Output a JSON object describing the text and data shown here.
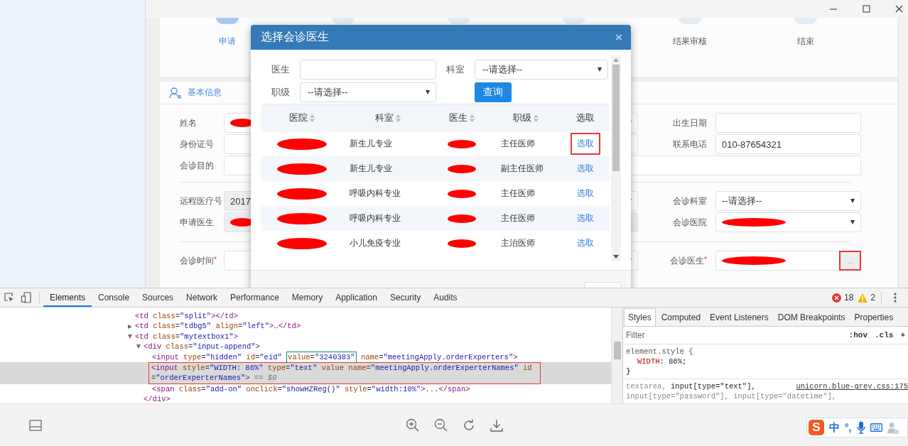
{
  "steps": [
    {
      "label": "申请",
      "selected": true
    },
    {
      "selected": false
    },
    {
      "selected": false
    },
    {
      "selected": false
    },
    {
      "label": "结果审核",
      "selected": false
    },
    {
      "label": "结束",
      "selected": false
    }
  ],
  "section": {
    "title": "基本信息"
  },
  "form_groups": [
    [
      {
        "left": {
          "label": "姓名",
          "kind": "text",
          "redacted": true
        },
        "middle": {
          "kind": "select"
        },
        "right": {
          "label": "出生日期",
          "kind": "text"
        }
      },
      {
        "left": {
          "label": "身份证号",
          "kind": "text"
        },
        "middle": {
          "kind": "text"
        },
        "right": {
          "label": "联系电话",
          "kind": "text",
          "value": "010-87654321"
        }
      },
      {
        "left": {
          "label": "会诊目的",
          "kind": "text",
          "wide": true
        }
      }
    ],
    [
      {
        "left": {
          "label": "远程医疗号",
          "kind": "text",
          "readonly": true,
          "value": "2017"
        },
        "middle": {
          "kind": "select"
        },
        "right": {
          "label": "会诊科室",
          "kind": "select",
          "value": "--请选择--"
        }
      },
      {
        "left": {
          "label": "申请医生",
          "kind": "text",
          "readonly": true,
          "redacted": true
        },
        "middle": {
          "kind": "text",
          "readonly": true
        },
        "right": {
          "label": "会诊医院",
          "kind": "select",
          "redacted": true
        }
      }
    ],
    [
      {
        "left": {
          "label": "会诊时间",
          "required_mark": "*",
          "kind": "text"
        },
        "middle": {
          "kind": "select"
        },
        "right": {
          "label": "会诊医生",
          "required_mark": "*",
          "kind": "lookup",
          "redacted": true,
          "button": "...",
          "annotated": true
        }
      }
    ]
  ],
  "modal": {
    "title": "选择会诊医生",
    "close": "×",
    "filters": [
      {
        "label": "医生",
        "kind": "text"
      },
      {
        "label": "科室",
        "kind": "select",
        "value": "--请选择--"
      },
      {
        "label": "职级",
        "kind": "select",
        "value": "--请选择--"
      }
    ],
    "search_button": "查询",
    "columns": [
      {
        "label": "医院",
        "sortable": true
      },
      {
        "label": "科室",
        "sortable": true
      },
      {
        "label": "医生",
        "sortable": true
      },
      {
        "label": "职级",
        "sortable": true
      },
      {
        "label": "选取",
        "sortable": false
      }
    ],
    "rows": [
      {
        "hospital_redacted": true,
        "department": "新生儿专业",
        "doctor_redacted": true,
        "title": "主任医师",
        "action": "选取",
        "annotated": true
      },
      {
        "hospital_redacted": true,
        "department": "新生儿专业",
        "doctor_redacted": true,
        "title": "副主任医师",
        "action": "选取",
        "annotated": false
      },
      {
        "hospital_redacted": true,
        "department": "呼吸内科专业",
        "doctor_redacted": true,
        "title": "主任医师",
        "action": "选取",
        "annotated": false
      },
      {
        "hospital_redacted": true,
        "department": "呼吸内科专业",
        "doctor_redacted": true,
        "title": "主任医师",
        "action": "选取",
        "annotated": false
      },
      {
        "hospital_redacted": true,
        "department": "小儿免疫专业",
        "doctor_redacted": true,
        "title": "主治医师",
        "action": "选取",
        "annotated": false
      }
    ]
  },
  "devtools": {
    "tabs": [
      {
        "label": "Elements",
        "selected": true
      },
      {
        "label": "Console",
        "selected": false
      },
      {
        "label": "Sources",
        "selected": false
      },
      {
        "label": "Network",
        "selected": false
      },
      {
        "label": "Performance",
        "selected": false
      },
      {
        "label": "Memory",
        "selected": false
      },
      {
        "label": "Application",
        "selected": false
      },
      {
        "label": "Security",
        "selected": false
      },
      {
        "label": "Audits",
        "selected": false
      }
    ],
    "errors": "18",
    "warnings": "2",
    "dom_tree": [
      {
        "kind": "leaf",
        "selected": false,
        "tokens": [
          {
            "kind": "tag",
            "text": "<td"
          },
          {
            "kind": "attr",
            "text": " class"
          },
          {
            "kind": "eq",
            "text": "="
          },
          {
            "kind": "value",
            "text": "\"split\""
          },
          {
            "kind": "tag",
            "text": "></td>"
          }
        ]
      },
      {
        "kind": "branch",
        "expanded": false,
        "selected": false,
        "tokens": [
          {
            "kind": "tag",
            "text": "<td"
          },
          {
            "kind": "attr",
            "text": " class"
          },
          {
            "kind": "eq",
            "text": "="
          },
          {
            "kind": "value",
            "text": "\"tdbg5\""
          },
          {
            "kind": "attr",
            "text": " align"
          },
          {
            "kind": "eq",
            "text": "="
          },
          {
            "kind": "value",
            "text": "\"left\""
          },
          {
            "kind": "tag",
            "text": ">"
          },
          {
            "kind": "plain",
            "text": "…"
          },
          {
            "kind": "tag",
            "text": "</td>"
          }
        ]
      },
      {
        "kind": "branch",
        "expanded": true,
        "selected": false,
        "tokens": [
          {
            "kind": "tag",
            "text": "<td"
          },
          {
            "kind": "attr",
            "text": " class"
          },
          {
            "kind": "eq",
            "text": "="
          },
          {
            "kind": "value",
            "text": "\"mytextbox1\""
          },
          {
            "kind": "tag",
            "text": ">"
          }
        ],
        "children": [
          {
            "kind": "branch",
            "expanded": true,
            "selected": false,
            "tokens": [
              {
                "kind": "tag",
                "text": "<div"
              },
              {
                "kind": "attr",
                "text": " class"
              },
              {
                "kind": "eq",
                "text": "="
              },
              {
                "kind": "value",
                "text": "\"input-append\""
              },
              {
                "kind": "tag",
                "text": ">"
              }
            ],
            "children": [
              {
                "kind": "leaf",
                "selected": false,
                "tokens": [
                  {
                    "kind": "tag",
                    "text": "<input"
                  },
                  {
                    "kind": "attr",
                    "text": " type"
                  },
                  {
                    "kind": "eq",
                    "text": "="
                  },
                  {
                    "kind": "value",
                    "text": "\"hidden\""
                  },
                  {
                    "kind": "attr",
                    "text": " id"
                  },
                  {
                    "kind": "eq",
                    "text": "="
                  },
                  {
                    "kind": "value",
                    "text": "\"eid\" "
                  },
                  {
                    "kind": "highlight",
                    "tokens": [
                      {
                        "kind": "attr",
                        "text": "value"
                      },
                      {
                        "kind": "eq",
                        "text": "="
                      },
                      {
                        "kind": "value",
                        "text": "\"3240383\""
                      }
                    ]
                  },
                  {
                    "kind": "attr",
                    "text": " name"
                  },
                  {
                    "kind": "eq",
                    "text": "="
                  },
                  {
                    "kind": "value",
                    "text": "\"meetingApply.orderExperters\""
                  },
                  {
                    "kind": "tag",
                    "text": ">"
                  }
                ]
              },
              {
                "kind": "leaf",
                "selected": true,
                "annotated": true,
                "tokens": [
                  {
                    "kind": "tag",
                    "text": "<input"
                  },
                  {
                    "kind": "attr",
                    "text": " style"
                  },
                  {
                    "kind": "eq",
                    "text": "="
                  },
                  {
                    "kind": "value",
                    "text": "\"WIDTH: 86%\""
                  },
                  {
                    "kind": "attr",
                    "text": " type"
                  },
                  {
                    "kind": "eq",
                    "text": "="
                  },
                  {
                    "kind": "value",
                    "text": "\"text\""
                  },
                  {
                    "kind": "attr",
                    "text": " value name"
                  },
                  {
                    "kind": "eq",
                    "text": "="
                  },
                  {
                    "kind": "value",
                    "text": "\"meetingApply.orderExperterNames\""
                  },
                  {
                    "kind": "attr",
                    "text": " id"
                  },
                  {
                    "kind": "eq",
                    "text": "="
                  },
                  {
                    "kind": "value",
                    "text": "\"orderExperterNames\""
                  },
                  {
                    "kind": "tag",
                    "text": ">"
                  },
                  {
                    "kind": "hint",
                    "text": " == $0"
                  }
                ]
              },
              {
                "kind": "leaf",
                "selected": false,
                "tokens": [
                  {
                    "kind": "tag",
                    "text": "<span"
                  },
                  {
                    "kind": "attr",
                    "text": " class"
                  },
                  {
                    "kind": "eq",
                    "text": "="
                  },
                  {
                    "kind": "value",
                    "text": "\"add-on\""
                  },
                  {
                    "kind": "attr",
                    "text": " onclick"
                  },
                  {
                    "kind": "eq",
                    "text": "="
                  },
                  {
                    "kind": "value",
                    "text": "\"showHZReg()\""
                  },
                  {
                    "kind": "attr",
                    "text": " style"
                  },
                  {
                    "kind": "eq",
                    "text": "="
                  },
                  {
                    "kind": "value",
                    "text": "\"width:10%\""
                  },
                  {
                    "kind": "tag",
                    "text": ">"
                  },
                  {
                    "kind": "plain",
                    "text": "..."
                  },
                  {
                    "kind": "tag",
                    "text": "</span>"
                  }
                ]
              }
            ]
          },
          {
            "kind": "leaf",
            "selected": false,
            "tokens": [
              {
                "kind": "tag",
                "text": "</div>"
              }
            ]
          }
        ]
      }
    ],
    "style_tabs": [
      {
        "label": "Styles",
        "selected": true
      },
      {
        "label": "Computed",
        "selected": false
      },
      {
        "label": "Event Listeners",
        "selected": false
      },
      {
        "label": "DOM Breakpoints",
        "selected": false
      },
      {
        "label": "Properties",
        "selected": false
      }
    ],
    "filter_placeholder": "Filter",
    "filter_buttons": [
      ":hov",
      ".cls",
      "+"
    ],
    "inline_rule": {
      "selector": "element.style {",
      "declarations": [
        {
          "property": "WIDTH",
          "colon": ":",
          "value": "86%;"
        }
      ],
      "close": "}"
    },
    "rule": {
      "selector_lines": [
        [
          {
            "text": "textarea,",
            "matched": false
          },
          {
            "text": "input[type=\"text\"],",
            "matched": true
          }
        ],
        [
          {
            "text": "input[type=\"password\"],",
            "matched": false
          },
          {
            "text": "input[type=\"datetime\"],",
            "matched": false
          }
        ]
      ],
      "source": "unicorn.blue-grey.css:175"
    }
  },
  "ime": {
    "logo": "S",
    "mode": "中",
    "punctuation": "°,"
  }
}
